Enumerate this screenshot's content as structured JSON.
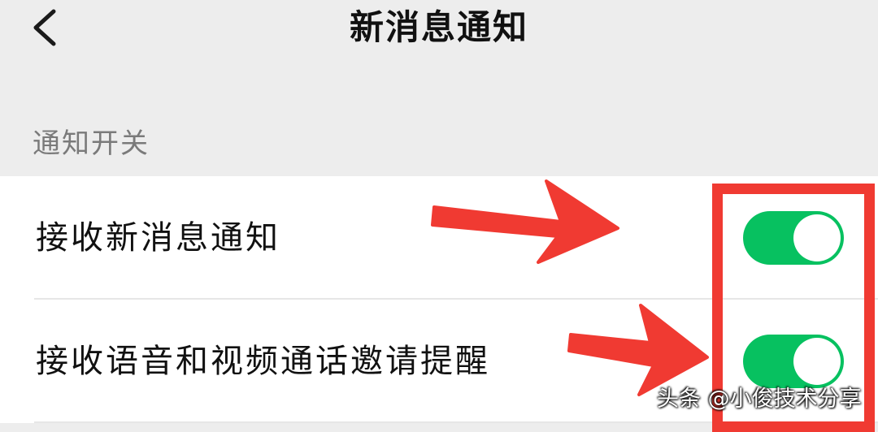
{
  "header": {
    "title": "新消息通知",
    "back_icon": "chevron-left-icon"
  },
  "section": {
    "label": "通知开关"
  },
  "settings": [
    {
      "label": "接收新消息通知",
      "enabled": true
    },
    {
      "label": "接收语音和视频通话邀请提醒",
      "enabled": true
    }
  ],
  "colors": {
    "background": "#ededed",
    "list_background": "#ffffff",
    "toggle_on": "#07c160",
    "annotation": "#f03a32"
  },
  "watermark": {
    "text": "头条 @小俊技术分享"
  }
}
